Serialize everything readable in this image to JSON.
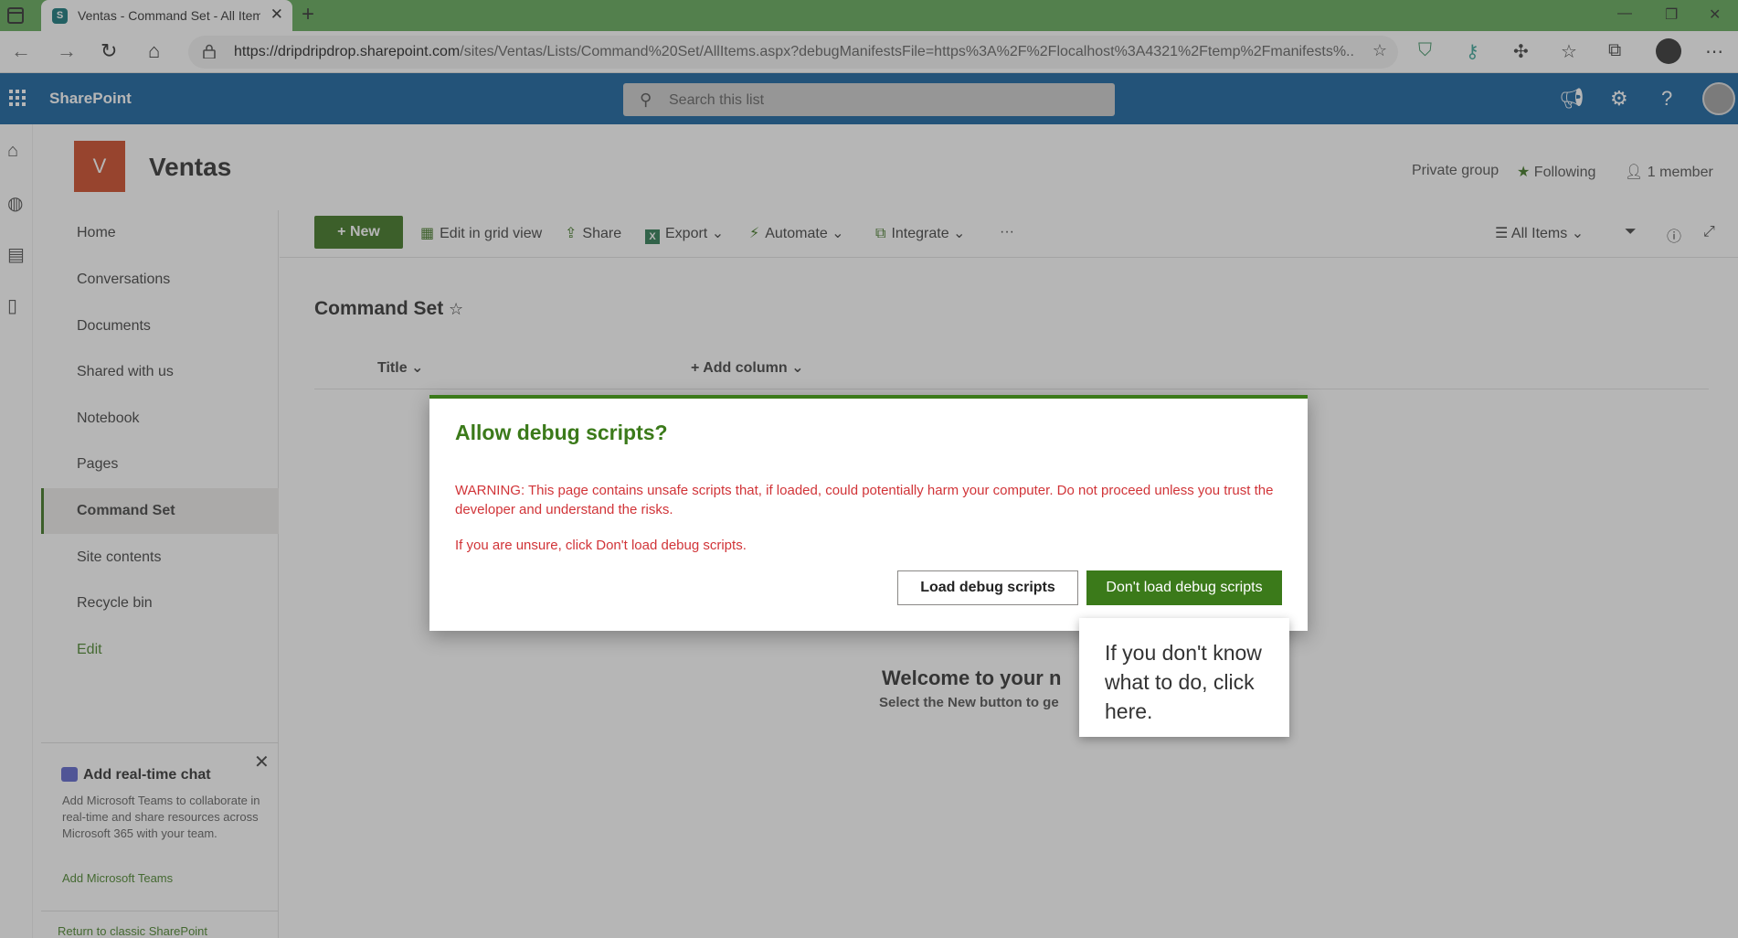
{
  "browser": {
    "tab_title": "Ventas - Command Set - All Items",
    "tab_favicon": "S",
    "url_host": "https://dripdripdrop.sharepoint.com",
    "url_rest": "/sites/Ventas/Lists/Command%20Set/AllItems.aspx?debugManifestsFile=https%3A%2F%2Flocalhost%3A4321%2Ftemp%2Fmanifests%..."
  },
  "suitebar": {
    "app_name": "SharePoint",
    "search_placeholder": "Search this list",
    "accent": "#035597"
  },
  "site": {
    "logo_letter": "V",
    "title": "Ventas",
    "privacy": "Private group",
    "following": "Following",
    "members": "1 member"
  },
  "leftnav": {
    "items": [
      {
        "label": "Home"
      },
      {
        "label": "Conversations"
      },
      {
        "label": "Documents"
      },
      {
        "label": "Shared with us"
      },
      {
        "label": "Notebook"
      },
      {
        "label": "Pages"
      },
      {
        "label": "Command Set"
      },
      {
        "label": "Site contents"
      },
      {
        "label": "Recycle bin"
      },
      {
        "label": "Edit"
      }
    ],
    "chat": {
      "title": "Add real-time chat",
      "description": "Add Microsoft Teams to collaborate in real-time and share resources across Microsoft 365 with your team.",
      "link": "Add Microsoft Teams"
    },
    "classic_link": "Return to classic SharePoint"
  },
  "commandbar": {
    "new": "New",
    "edit_grid": "Edit in grid view",
    "share": "Share",
    "export": "Export",
    "automate": "Automate",
    "integrate": "Integrate",
    "view": "All Items"
  },
  "list": {
    "title": "Command Set",
    "columns": {
      "title": "Title",
      "add": "Add column"
    },
    "welcome": "Welcome to your n",
    "welcome_sub": "Select the New button to ge"
  },
  "dialog": {
    "title": "Allow debug scripts?",
    "warning": "WARNING: This page contains unsafe scripts that, if loaded, could potentially harm your computer. Do not proceed unless you trust the developer and understand the risks.",
    "unsure": "If you are unsure, click Don't load debug scripts.",
    "load_button": "Load debug scripts",
    "dont_load_button": "Don't load debug scripts",
    "accent": "#3b7a1a",
    "warning_color": "#d13438"
  },
  "callout": {
    "text": "If you don't know what to do, click here."
  }
}
